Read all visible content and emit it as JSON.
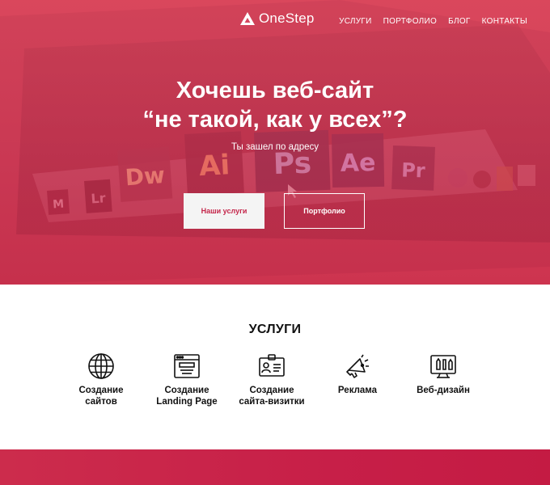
{
  "brand": {
    "name": "OneStep"
  },
  "nav": [
    "УСЛУГИ",
    "ПОРТФОЛИО",
    "БЛОГ",
    "КОНТАКТЫ"
  ],
  "hero": {
    "title_line1": "Хочешь веб-сайт",
    "title_line2": "“не такой, как у всех”?",
    "subtitle": "Ты зашел по адресу",
    "btn_primary": "Наши услуги",
    "btn_secondary": "Портфолио",
    "app_tiles": [
      "M",
      "Lr",
      "Dw",
      "Ai",
      "Ps",
      "Ae",
      "Pr"
    ]
  },
  "services": {
    "title": "УСЛУГИ",
    "items": [
      {
        "line1": "Создание",
        "line2": "сайтов",
        "icon": "globe-icon"
      },
      {
        "line1": "Создание",
        "line2": "Landing Page",
        "icon": "browser-window-icon"
      },
      {
        "line1": "Создание",
        "line2": "сайта-визитки",
        "icon": "id-card-icon"
      },
      {
        "line1": "Реклама",
        "line2": "",
        "icon": "megaphone-icon"
      },
      {
        "line1": "Веб-дизайн",
        "line2": "",
        "icon": "design-monitor-icon"
      }
    ]
  },
  "colors": {
    "accent": "#c4264a",
    "hero_overlay": "#d9485c",
    "footer": "#c71f48"
  }
}
